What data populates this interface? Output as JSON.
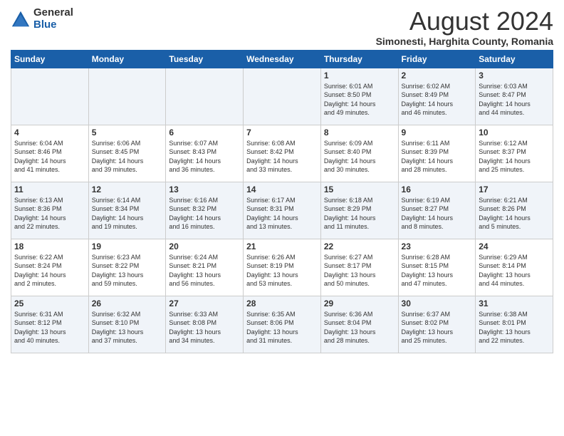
{
  "logo": {
    "general": "General",
    "blue": "Blue"
  },
  "title": "August 2024",
  "subtitle": "Simonesti, Harghita County, Romania",
  "days_of_week": [
    "Sunday",
    "Monday",
    "Tuesday",
    "Wednesday",
    "Thursday",
    "Friday",
    "Saturday"
  ],
  "weeks": [
    [
      {
        "day": "",
        "info": ""
      },
      {
        "day": "",
        "info": ""
      },
      {
        "day": "",
        "info": ""
      },
      {
        "day": "",
        "info": ""
      },
      {
        "day": "1",
        "info": "Sunrise: 6:01 AM\nSunset: 8:50 PM\nDaylight: 14 hours\nand 49 minutes."
      },
      {
        "day": "2",
        "info": "Sunrise: 6:02 AM\nSunset: 8:49 PM\nDaylight: 14 hours\nand 46 minutes."
      },
      {
        "day": "3",
        "info": "Sunrise: 6:03 AM\nSunset: 8:47 PM\nDaylight: 14 hours\nand 44 minutes."
      }
    ],
    [
      {
        "day": "4",
        "info": "Sunrise: 6:04 AM\nSunset: 8:46 PM\nDaylight: 14 hours\nand 41 minutes."
      },
      {
        "day": "5",
        "info": "Sunrise: 6:06 AM\nSunset: 8:45 PM\nDaylight: 14 hours\nand 39 minutes."
      },
      {
        "day": "6",
        "info": "Sunrise: 6:07 AM\nSunset: 8:43 PM\nDaylight: 14 hours\nand 36 minutes."
      },
      {
        "day": "7",
        "info": "Sunrise: 6:08 AM\nSunset: 8:42 PM\nDaylight: 14 hours\nand 33 minutes."
      },
      {
        "day": "8",
        "info": "Sunrise: 6:09 AM\nSunset: 8:40 PM\nDaylight: 14 hours\nand 30 minutes."
      },
      {
        "day": "9",
        "info": "Sunrise: 6:11 AM\nSunset: 8:39 PM\nDaylight: 14 hours\nand 28 minutes."
      },
      {
        "day": "10",
        "info": "Sunrise: 6:12 AM\nSunset: 8:37 PM\nDaylight: 14 hours\nand 25 minutes."
      }
    ],
    [
      {
        "day": "11",
        "info": "Sunrise: 6:13 AM\nSunset: 8:36 PM\nDaylight: 14 hours\nand 22 minutes."
      },
      {
        "day": "12",
        "info": "Sunrise: 6:14 AM\nSunset: 8:34 PM\nDaylight: 14 hours\nand 19 minutes."
      },
      {
        "day": "13",
        "info": "Sunrise: 6:16 AM\nSunset: 8:32 PM\nDaylight: 14 hours\nand 16 minutes."
      },
      {
        "day": "14",
        "info": "Sunrise: 6:17 AM\nSunset: 8:31 PM\nDaylight: 14 hours\nand 13 minutes."
      },
      {
        "day": "15",
        "info": "Sunrise: 6:18 AM\nSunset: 8:29 PM\nDaylight: 14 hours\nand 11 minutes."
      },
      {
        "day": "16",
        "info": "Sunrise: 6:19 AM\nSunset: 8:27 PM\nDaylight: 14 hours\nand 8 minutes."
      },
      {
        "day": "17",
        "info": "Sunrise: 6:21 AM\nSunset: 8:26 PM\nDaylight: 14 hours\nand 5 minutes."
      }
    ],
    [
      {
        "day": "18",
        "info": "Sunrise: 6:22 AM\nSunset: 8:24 PM\nDaylight: 14 hours\nand 2 minutes."
      },
      {
        "day": "19",
        "info": "Sunrise: 6:23 AM\nSunset: 8:22 PM\nDaylight: 13 hours\nand 59 minutes."
      },
      {
        "day": "20",
        "info": "Sunrise: 6:24 AM\nSunset: 8:21 PM\nDaylight: 13 hours\nand 56 minutes."
      },
      {
        "day": "21",
        "info": "Sunrise: 6:26 AM\nSunset: 8:19 PM\nDaylight: 13 hours\nand 53 minutes."
      },
      {
        "day": "22",
        "info": "Sunrise: 6:27 AM\nSunset: 8:17 PM\nDaylight: 13 hours\nand 50 minutes."
      },
      {
        "day": "23",
        "info": "Sunrise: 6:28 AM\nSunset: 8:15 PM\nDaylight: 13 hours\nand 47 minutes."
      },
      {
        "day": "24",
        "info": "Sunrise: 6:29 AM\nSunset: 8:14 PM\nDaylight: 13 hours\nand 44 minutes."
      }
    ],
    [
      {
        "day": "25",
        "info": "Sunrise: 6:31 AM\nSunset: 8:12 PM\nDaylight: 13 hours\nand 40 minutes."
      },
      {
        "day": "26",
        "info": "Sunrise: 6:32 AM\nSunset: 8:10 PM\nDaylight: 13 hours\nand 37 minutes."
      },
      {
        "day": "27",
        "info": "Sunrise: 6:33 AM\nSunset: 8:08 PM\nDaylight: 13 hours\nand 34 minutes."
      },
      {
        "day": "28",
        "info": "Sunrise: 6:35 AM\nSunset: 8:06 PM\nDaylight: 13 hours\nand 31 minutes."
      },
      {
        "day": "29",
        "info": "Sunrise: 6:36 AM\nSunset: 8:04 PM\nDaylight: 13 hours\nand 28 minutes."
      },
      {
        "day": "30",
        "info": "Sunrise: 6:37 AM\nSunset: 8:02 PM\nDaylight: 13 hours\nand 25 minutes."
      },
      {
        "day": "31",
        "info": "Sunrise: 6:38 AM\nSunset: 8:01 PM\nDaylight: 13 hours\nand 22 minutes."
      }
    ]
  ]
}
